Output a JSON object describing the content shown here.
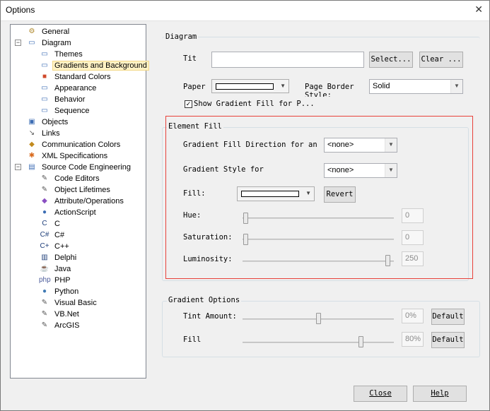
{
  "window": {
    "title": "Options",
    "close_glyph": "✕"
  },
  "tree": [
    {
      "label": "General",
      "icon": "general-icon",
      "glyph": "⚙",
      "color": "#b08a2e"
    },
    {
      "label": "Diagram",
      "icon": "diagram-icon",
      "glyph": "▭",
      "color": "#3c6db4",
      "expander": "−"
    },
    {
      "label": "Themes",
      "icon": "themes-icon",
      "glyph": "▭",
      "color": "#3c6db4"
    },
    {
      "label": "Gradients and Background",
      "icon": "gradients-icon",
      "glyph": "▭",
      "color": "#3c6db4",
      "selected": true
    },
    {
      "label": "Standard Colors",
      "icon": "standard-colors-icon",
      "glyph": "■",
      "color": "#d04a2c"
    },
    {
      "label": "Appearance",
      "icon": "appearance-icon",
      "glyph": "▭",
      "color": "#3c6db4"
    },
    {
      "label": "Behavior",
      "icon": "behavior-icon",
      "glyph": "▭",
      "color": "#3c6db4"
    },
    {
      "label": "Sequence",
      "icon": "sequence-icon",
      "glyph": "▭",
      "color": "#3c6db4"
    },
    {
      "label": "Objects",
      "icon": "objects-icon",
      "glyph": "▣",
      "color": "#3c6db4"
    },
    {
      "label": "Links",
      "icon": "links-icon",
      "glyph": "↘",
      "color": "#555555"
    },
    {
      "label": "Communication Colors",
      "icon": "communication-colors-icon",
      "glyph": "◆",
      "color": "#c28a1e"
    },
    {
      "label": "XML Specifications",
      "icon": "xml-icon",
      "glyph": "✱",
      "color": "#d96b1e"
    },
    {
      "label": "Source Code Engineering",
      "icon": "source-code-icon",
      "glyph": "▤",
      "color": "#3c6db4",
      "expander": "−"
    },
    {
      "label": "Code Editors",
      "icon": "code-editors-icon",
      "glyph": "✎",
      "color": "#555555"
    },
    {
      "label": "Object Lifetimes",
      "icon": "object-lifetimes-icon",
      "glyph": "✎",
      "color": "#555555"
    },
    {
      "label": "Attribute/Operations",
      "icon": "attribute-operations-icon",
      "glyph": "◆",
      "color": "#8a4fc2"
    },
    {
      "label": "ActionScript",
      "icon": "actionscript-icon",
      "glyph": "●",
      "color": "#3c6db4"
    },
    {
      "label": "C",
      "icon": "c-icon",
      "glyph": "C",
      "color": "#1f3f7a"
    },
    {
      "label": "C#",
      "icon": "csharp-icon",
      "glyph": "C#",
      "color": "#1f3f7a"
    },
    {
      "label": "C++",
      "icon": "cpp-icon",
      "glyph": "C+",
      "color": "#1f3f7a"
    },
    {
      "label": "Delphi",
      "icon": "delphi-icon",
      "glyph": "▥",
      "color": "#1f3f7a"
    },
    {
      "label": "Java",
      "icon": "java-icon",
      "glyph": "☕",
      "color": "#7a4a1e"
    },
    {
      "label": "PHP",
      "icon": "php-icon",
      "glyph": "php",
      "color": "#4a5a9a"
    },
    {
      "label": "Python",
      "icon": "python-icon",
      "glyph": "●",
      "color": "#3f7ab4"
    },
    {
      "label": "Visual Basic",
      "icon": "visual-basic-icon",
      "glyph": "✎",
      "color": "#555555"
    },
    {
      "label": "VB.Net",
      "icon": "vbnet-icon",
      "glyph": "✎",
      "color": "#555555"
    },
    {
      "label": "ArcGIS",
      "icon": "arcgis-icon",
      "glyph": "✎",
      "color": "#555555"
    }
  ],
  "diagram": {
    "group_label": "Diagram",
    "title_label": "Tit",
    "title_value": "",
    "select_button": "Select...",
    "clear_button": "Clear ...",
    "paper_label": "Paper",
    "page_border_label": "Page Border Style:",
    "page_border_value": "Solid",
    "show_gradient_label": "Show Gradient Fill for P...",
    "show_gradient_checked": true
  },
  "element_fill": {
    "group_label": "Element Fill",
    "gradient_direction_label": "Gradient Fill Direction for an",
    "gradient_direction_value": "<none>",
    "gradient_style_label": "Gradient Style for",
    "gradient_style_value": "<none>",
    "fill_label": "Fill:",
    "revert_button": "Revert",
    "hue_label": "Hue:",
    "hue_value": "0",
    "saturation_label": "Saturation:",
    "saturation_value": "0",
    "luminosity_label": "Luminosity:",
    "luminosity_value": "250"
  },
  "gradient_options": {
    "group_label": "Gradient Options",
    "tint_label": "Tint Amount:",
    "tint_value": "0%",
    "tint_default": "Default",
    "fill_label": "Fill",
    "fill_value": "80%",
    "fill_default": "Default"
  },
  "footer": {
    "close_button": "Close",
    "help_button": "Help"
  },
  "colors": {
    "highlight_border": "#e8413a",
    "selection": "#fff2c4"
  }
}
